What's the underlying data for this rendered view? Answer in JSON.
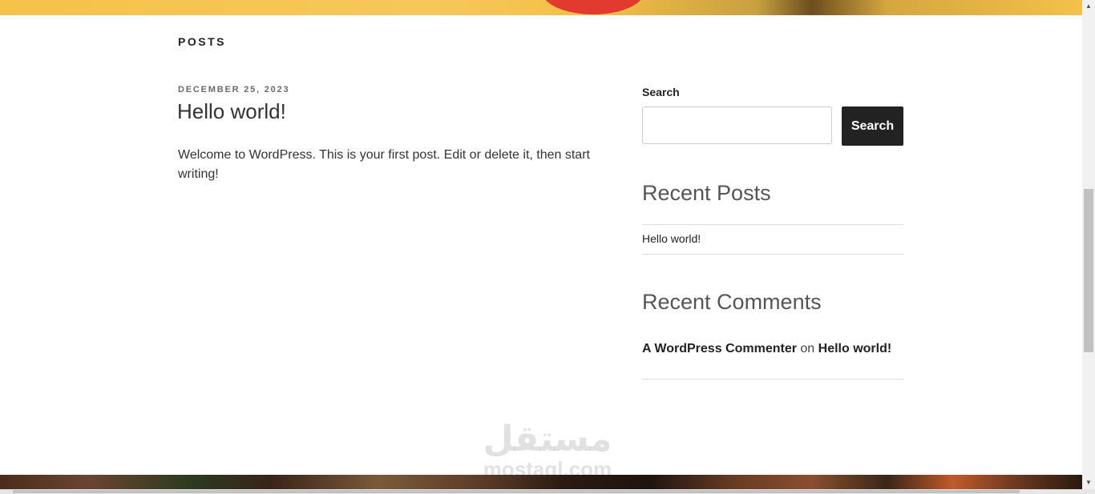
{
  "section": {
    "title": "POSTS"
  },
  "post": {
    "date": "DECEMBER 25, 2023",
    "title": "Hello world!",
    "excerpt": "Welcome to WordPress. This is your first post. Edit or delete it, then start writing!"
  },
  "sidebar": {
    "search": {
      "label": "Search",
      "placeholder": "",
      "value": "",
      "button_label": "Search"
    },
    "recent_posts": {
      "heading": "Recent Posts",
      "items": [
        "Hello world!"
      ]
    },
    "recent_comments": {
      "heading": "Recent Comments",
      "items": [
        {
          "author": "A WordPress Commenter",
          "connector": "on",
          "post": "Hello world!"
        }
      ]
    }
  },
  "watermark": {
    "arabic": "مستقل",
    "latin": "mostaql.com"
  },
  "scrollbar": {
    "up_icon": "arrow-up-icon",
    "down_icon": "arrow-down-icon"
  }
}
